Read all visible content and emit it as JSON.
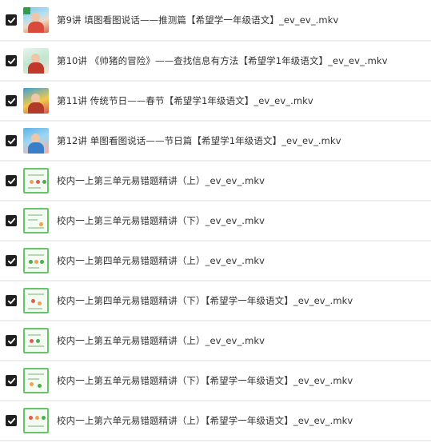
{
  "files": [
    {
      "name": "第9讲 填图看图说话——推测篇【希望学一年级语文】_ev_ev_.mkv",
      "checked": true,
      "thumbnail": "video-thumbnail-photo"
    },
    {
      "name": "第10讲 《帅猪的冒险》——查找信息有方法【希望学1年级语文】_ev_ev_.mkv",
      "checked": true,
      "thumbnail": "video-thumbnail-photo"
    },
    {
      "name": "第11讲 传统节日——春节【希望学1年级语文】_ev_ev_.mkv",
      "checked": true,
      "thumbnail": "video-thumbnail-photo"
    },
    {
      "name": "第12讲 单图看图说话——节日篇【希望学1年级语文】_ev_ev_.mkv",
      "checked": true,
      "thumbnail": "video-thumbnail-photo"
    },
    {
      "name": "校内一上第三单元易错题精讲（上）_ev_ev_.mkv",
      "checked": true,
      "thumbnail": "video-thumbnail-slide"
    },
    {
      "name": "校内一上第三单元易错题精讲（下）_ev_ev_.mkv",
      "checked": true,
      "thumbnail": "video-thumbnail-slide"
    },
    {
      "name": "校内一上第四单元易错题精讲（上）_ev_ev_.mkv",
      "checked": true,
      "thumbnail": "video-thumbnail-slide"
    },
    {
      "name": "校内一上第四单元易错题精讲（下）【希望学一年级语文】_ev_ev_.mkv",
      "checked": true,
      "thumbnail": "video-thumbnail-slide"
    },
    {
      "name": "校内一上第五单元易错题精讲（上）_ev_ev_.mkv",
      "checked": true,
      "thumbnail": "video-thumbnail-slide"
    },
    {
      "name": "校内一上第五单元易错题精讲（下）【希望学一年级语文】_ev_ev_.mkv",
      "checked": true,
      "thumbnail": "video-thumbnail-slide"
    },
    {
      "name": "校内一上第六单元易错题精讲（上）【希望学一年级语文】_ev_ev_.mkv",
      "checked": true,
      "thumbnail": "video-thumbnail-slide"
    }
  ],
  "colors": {
    "checkbox": "#1f1f1f",
    "row_divider": "#eeeeee",
    "text": "#333333",
    "slide_border": "#68c46a"
  },
  "icons": {
    "checkbox": "checkmark-icon"
  }
}
